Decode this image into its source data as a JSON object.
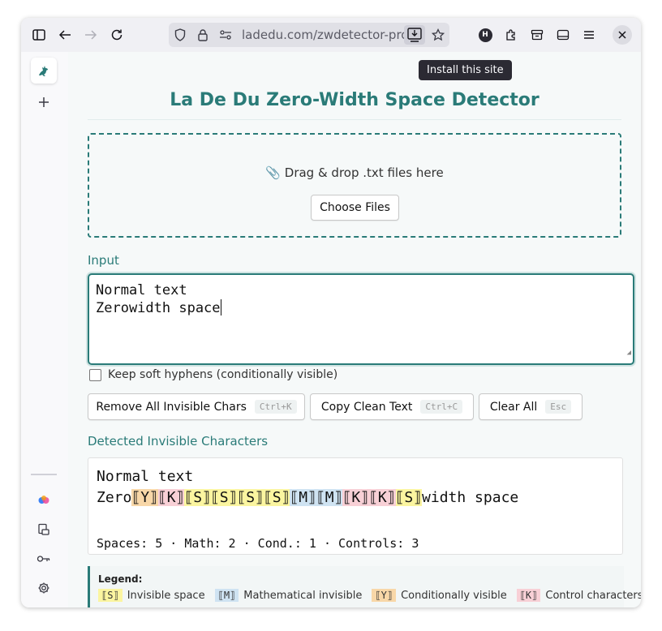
{
  "browser": {
    "url_text": "ladedu.com/zwdetector-pro/",
    "tooltip": "Install this site",
    "profile_initial": "H"
  },
  "page": {
    "title": "La De Du Zero-Width Space Detector",
    "dropzone": {
      "text": "📎 Drag & drop .txt files here",
      "button_label": "Choose Files"
    },
    "input_label": "Input",
    "input_line1": "Normal text",
    "input_line2": "Zerowidth space",
    "checkbox_label": "Keep soft hyphens (conditionally visible)",
    "actions": [
      {
        "label": "Remove All Invisible Chars",
        "shortcut": "Ctrl+K"
      },
      {
        "label": "Copy Clean Text",
        "shortcut": "Ctrl+C"
      },
      {
        "label": "Clear All",
        "shortcut": "Esc"
      }
    ],
    "detected_label": "Detected Invisible Characters",
    "output": {
      "line1": "Normal text",
      "line2_prefix": "Zero",
      "markers": [
        "⟦Y⟧",
        "⟦K⟧",
        "⟦S⟧",
        "⟦S⟧",
        "⟦S⟧",
        "⟦S⟧",
        "⟦M⟧",
        "⟦M⟧",
        "⟦K⟧",
        "⟦K⟧",
        "⟦S⟧"
      ],
      "line2_suffix": "width space",
      "stats": "Spaces: 5 · Math: 2 · Cond.: 1 · Controls: 3"
    },
    "legend": {
      "title": "Legend:",
      "items": [
        {
          "marker": "⟦S⟧",
          "label": "Invisible space"
        },
        {
          "marker": "⟦M⟧",
          "label": "Mathematical invisible"
        },
        {
          "marker": "⟦Y⟧",
          "label": "Conditionally visible"
        },
        {
          "marker": "⟦K⟧",
          "label": "Control characters"
        }
      ]
    }
  },
  "colors": {
    "accent": "#2a7b78",
    "space": "#fbf5a0",
    "math": "#cfe3f2",
    "conditional": "#f8d7a8",
    "control": "#f8d0d6"
  },
  "icons": [
    "sidebar-toggle-icon",
    "back-icon",
    "forward-icon",
    "reload-icon",
    "shield-icon",
    "lock-icon",
    "permissions-icon",
    "install-icon",
    "star-icon",
    "extensions-icon",
    "container-icon",
    "reader-icon",
    "menu-icon",
    "close-icon",
    "kangaroo-logo-icon",
    "plus-icon",
    "copilot-icon",
    "page-icon",
    "key-icon",
    "gear-icon"
  ]
}
